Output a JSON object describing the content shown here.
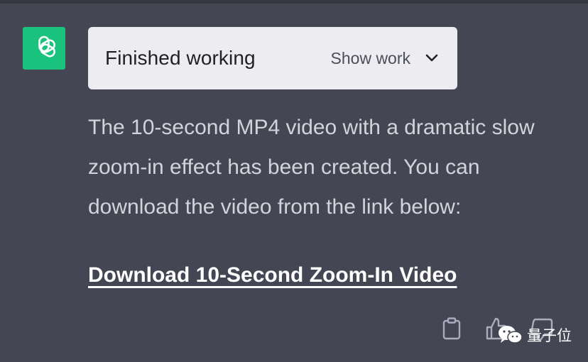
{
  "message": {
    "avatar_icon": "openai-logo-icon",
    "work_panel": {
      "title": "Finished working",
      "toggle_label": "Show work",
      "toggle_icon": "chevron-down-icon"
    },
    "text": "The 10-second MP4 video with a dramatic slow zoom-in effect has been created. You can download the video from the link below:",
    "link_text": "Download 10-Second Zoom-In Video"
  },
  "actions": {
    "copy_icon": "clipboard-icon",
    "thumbs_up_icon": "thumbs-up-icon",
    "thumbs_down_icon": "thumbs-down-icon"
  },
  "watermark": {
    "icon": "wechat-icon",
    "text": "量子位"
  },
  "colors": {
    "background": "#444654",
    "avatar": "#19c37d",
    "panel": "#ececf1",
    "text": "#d1d5db",
    "link": "#ffffff"
  }
}
